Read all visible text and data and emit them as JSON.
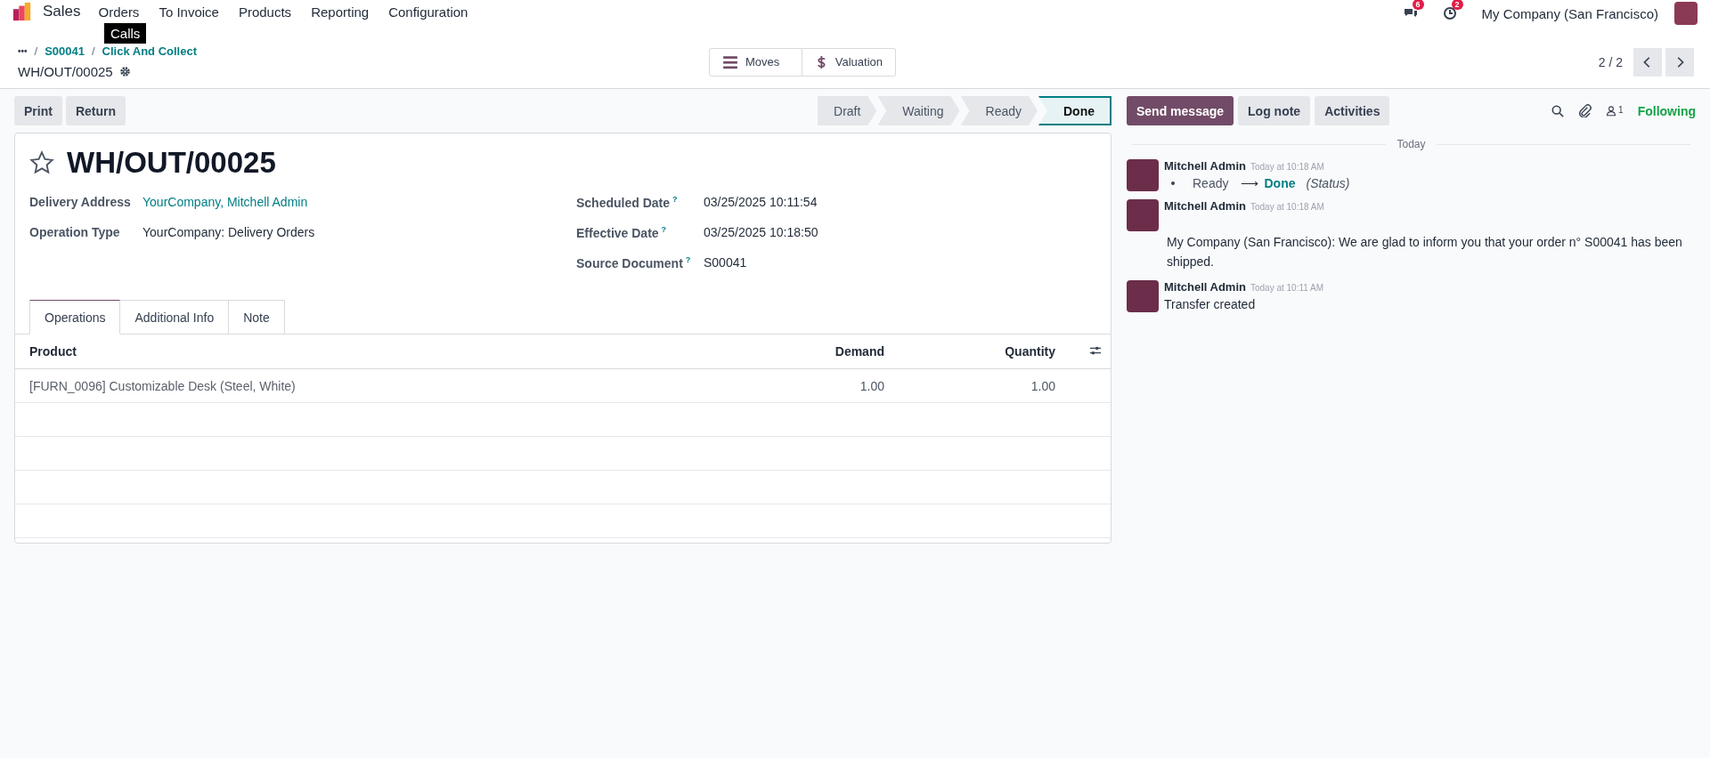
{
  "navbar": {
    "app": "Sales",
    "menu": [
      {
        "label": "Orders"
      },
      {
        "label": "To Invoice"
      },
      {
        "label": "Products"
      },
      {
        "label": "Reporting"
      },
      {
        "label": "Configuration"
      }
    ],
    "tooltip": "Calls",
    "messages_badge": "6",
    "activities_badge": "2",
    "company": "My Company (San Francisco)"
  },
  "control_panel": {
    "separator": "/",
    "breadcrumbs": [
      {
        "label": "•••"
      },
      {
        "label": "S00041"
      },
      {
        "label": "Click And Collect"
      }
    ],
    "record": "WH/OUT/00025",
    "smart_buttons": [
      {
        "label": "Moves",
        "kind": "list"
      },
      {
        "label": "Valuation",
        "kind": "dollar"
      }
    ],
    "pager": "2 / 2"
  },
  "actions": [
    "Print",
    "Return"
  ],
  "statusbar": [
    {
      "label": "Draft",
      "selected": false
    },
    {
      "label": "Waiting",
      "selected": false
    },
    {
      "label": "Ready",
      "selected": false
    },
    {
      "label": "Done",
      "selected": true
    }
  ],
  "form": {
    "title": "WH/OUT/00025",
    "starred": false,
    "left_fields": [
      {
        "label": "Delivery Address",
        "value": "YourCompany, Mitchell Admin",
        "kind": "link"
      },
      {
        "label": "Operation Type",
        "value": "YourCompany: Delivery Orders",
        "kind": "text"
      }
    ],
    "right_fields": [
      {
        "label": "Scheduled Date",
        "help": "?",
        "value": "03/25/2025 10:11:54"
      },
      {
        "label": "Effective Date",
        "help": "?",
        "value": "03/25/2025 10:18:50"
      },
      {
        "label": "Source Document",
        "help": "?",
        "value": "S00041"
      }
    ],
    "tabs": [
      {
        "label": "Operations",
        "selected": true
      },
      {
        "label": "Additional Info",
        "selected": false
      },
      {
        "label": "Note",
        "selected": false
      }
    ],
    "table": {
      "columns": [
        "Product",
        "Demand",
        "Quantity"
      ],
      "rows": [
        [
          "[FURN_0096] Customizable Desk (Steel, White)",
          "1.00",
          "1.00"
        ]
      ]
    }
  },
  "chatter": {
    "buttons": [
      {
        "label": "Send message",
        "selected": true
      },
      {
        "label": "Log note",
        "selected": false
      },
      {
        "label": "Activities",
        "selected": false
      }
    ],
    "followers_count": "1",
    "follow_label": "Following",
    "date_separator": "Today",
    "messages": [
      {
        "author": "Mitchell Admin",
        "time": "Today at 10:18 AM",
        "kind": "tracking",
        "old": "Ready",
        "arrow": "⟶",
        "new": "Done",
        "field": "(Status)"
      },
      {
        "author": "Mitchell Admin",
        "time": "Today at 10:18 AM",
        "kind": "body",
        "text": "My Company (San Francisco): We are glad to inform you that your order n° S00041 has been shipped."
      },
      {
        "author": "Mitchell Admin",
        "time": "Today at 10:11 AM",
        "kind": "text",
        "text": "Transfer created"
      }
    ]
  }
}
